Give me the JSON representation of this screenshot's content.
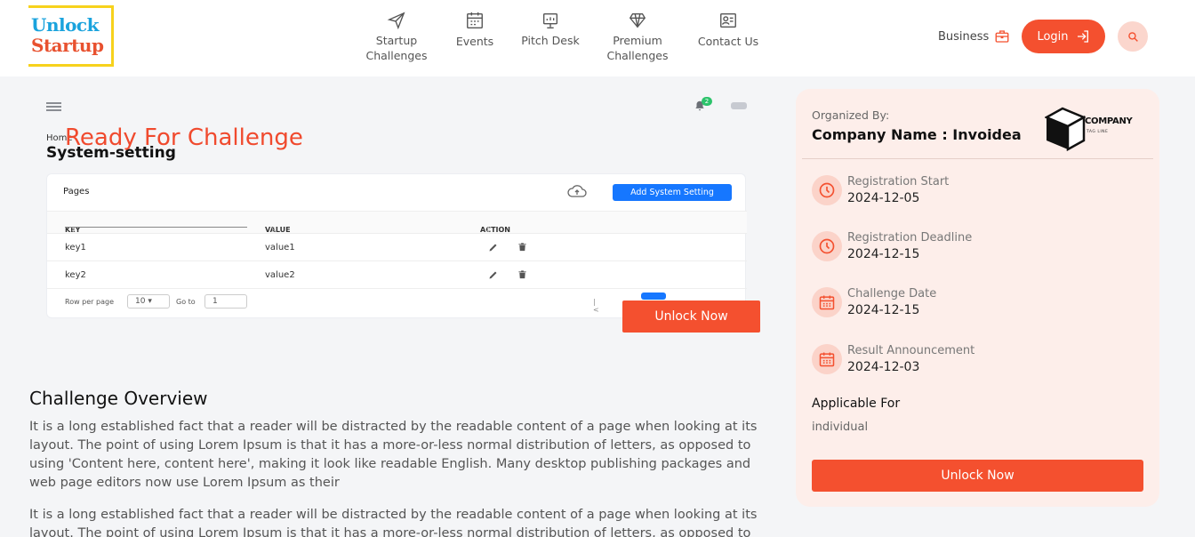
{
  "header": {
    "logo": {
      "line1": "Unlock",
      "line2": "Startup"
    },
    "nav": [
      {
        "line1": "Startup",
        "line2": "Challenges",
        "icon": "paper-plane-icon"
      },
      {
        "line1": "Events",
        "line2": "",
        "icon": "calendar-icon"
      },
      {
        "line1": "Pitch Desk",
        "line2": "",
        "icon": "presentation-icon"
      },
      {
        "line1": "Premium",
        "line2": "Challenges",
        "icon": "diamond-icon"
      },
      {
        "line1": "Contact Us",
        "line2": "",
        "icon": "contact-card-icon"
      }
    ],
    "business_label": "Business",
    "login_label": "Login"
  },
  "banner": {
    "breadcrumb": "Home",
    "title": "System-setting",
    "overlay_heading": "Ready For Challenge",
    "notification_count": "2",
    "card": {
      "pages_label": "Pages",
      "add_button": "Add System Setting",
      "columns": [
        "KEY",
        "VALUE",
        "ACTION"
      ],
      "rows": [
        {
          "key": "key1",
          "value": "value1"
        },
        {
          "key": "key2",
          "value": "value2"
        }
      ],
      "row_per_page_label": "Row per page",
      "row_per_page_value": "10",
      "goto_label": "Go to",
      "goto_value": "1",
      "first_page": "|<"
    }
  },
  "unlock_float_label": "Unlock Now",
  "overview": {
    "title": "Challenge Overview",
    "paragraphs": [
      "It is a long established fact that a reader will be distracted by the readable content of a page when looking at its layout. The point of using Lorem Ipsum is that it has a more-or-less normal distribution of letters, as opposed to using 'Content here, content here', making it look like readable English. Many desktop publishing packages and web page editors now use Lorem Ipsum as their",
      "It is a long established fact that a reader will be distracted by the readable content of a page when looking at its layout. The point of using Lorem Ipsum is that it has a more-or-less normal distribution of letters, as opposed to"
    ]
  },
  "panel": {
    "organized_by_label": "Organized By:",
    "company_name": "Company Name : Invoidea",
    "company_logo_text": "COMPANY",
    "company_logo_tagline": "TAG LINE",
    "dates": [
      {
        "label": "Registration Start",
        "value": "2024-12-05",
        "icon": "clock-icon"
      },
      {
        "label": "Registration Deadline",
        "value": "2024-12-15",
        "icon": "clock-icon"
      },
      {
        "label": "Challenge Date",
        "value": "2024-12-15",
        "icon": "calendar-icon"
      },
      {
        "label": "Result Announcement",
        "value": "2024-12-03",
        "icon": "calendar-icon"
      }
    ],
    "applicable_for_label": "Applicable For",
    "applicable_for_value": "individual",
    "unlock_button": "Unlock Now"
  },
  "colors": {
    "accent": "#f4502f",
    "accent_soft": "#fdeeea",
    "primary_blue": "#1677ff",
    "logo_blue": "#1aa3dd",
    "logo_yellow": "#f7d21c"
  }
}
